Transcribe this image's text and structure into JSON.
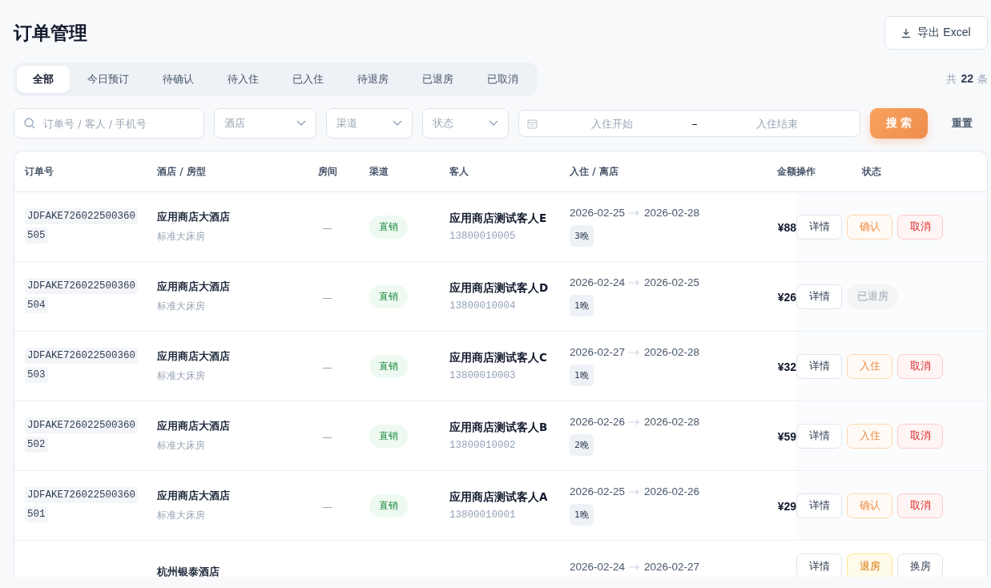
{
  "page_title": "订单管理",
  "export_button": "导出 Excel",
  "tabs": [
    {
      "label": "全部",
      "selected": true
    },
    {
      "label": "今日预订",
      "selected": false
    },
    {
      "label": "待确认",
      "selected": false
    },
    {
      "label": "待入住",
      "selected": false
    },
    {
      "label": "已入住",
      "selected": false
    },
    {
      "label": "待退房",
      "selected": false
    },
    {
      "label": "已退房",
      "selected": false
    },
    {
      "label": "已取消",
      "selected": false
    }
  ],
  "total": {
    "prefix": "共",
    "count": "22",
    "suffix": "条"
  },
  "filters": {
    "search_placeholder": "订单号 / 客人 / 手机号",
    "hotel_placeholder": "酒店",
    "channel_placeholder": "渠道",
    "status_placeholder": "状态",
    "date_start_placeholder": "入住开始",
    "date_separator": "–",
    "date_end_placeholder": "入住结束",
    "search_button": "搜 索",
    "reset_button": "重置"
  },
  "table": {
    "columns": [
      "订单号",
      "酒店 / 房型",
      "房间",
      "渠道",
      "客人",
      "入住 / 离店",
      "金额",
      "操作",
      "状态"
    ],
    "rows": [
      {
        "order_no": "JDFAKE726022500360505",
        "hotel": "应用商店大酒店",
        "room_type": "标准大床房",
        "room": "—",
        "channel": "直销",
        "guest": "应用商店测试客人E",
        "phone": "13800010005",
        "checkin": "2026-02-25",
        "checkout": "2026-02-28",
        "nights": "3晚",
        "amount": "¥88",
        "actions": [
          {
            "label": "详情",
            "kind": "default"
          },
          {
            "label": "确认",
            "kind": "warn"
          },
          {
            "label": "取消",
            "kind": "danger"
          }
        ]
      },
      {
        "order_no": "JDFAKE726022500360504",
        "hotel": "应用商店大酒店",
        "room_type": "标准大床房",
        "room": "—",
        "channel": "直销",
        "guest": "应用商店测试客人D",
        "phone": "13800010004",
        "checkin": "2026-02-24",
        "checkout": "2026-02-25",
        "nights": "1晚",
        "amount": "¥26",
        "actions": [
          {
            "label": "详情",
            "kind": "default"
          },
          {
            "label": "已退房",
            "kind": "disabled"
          }
        ]
      },
      {
        "order_no": "JDFAKE726022500360503",
        "hotel": "应用商店大酒店",
        "room_type": "标准大床房",
        "room": "—",
        "channel": "直销",
        "guest": "应用商店测试客人C",
        "phone": "13800010003",
        "checkin": "2026-02-27",
        "checkout": "2026-02-28",
        "nights": "1晚",
        "amount": "¥32",
        "actions": [
          {
            "label": "详情",
            "kind": "default"
          },
          {
            "label": "入住",
            "kind": "warn"
          },
          {
            "label": "取消",
            "kind": "danger"
          }
        ]
      },
      {
        "order_no": "JDFAKE726022500360502",
        "hotel": "应用商店大酒店",
        "room_type": "标准大床房",
        "room": "—",
        "channel": "直销",
        "guest": "应用商店测试客人B",
        "phone": "13800010002",
        "checkin": "2026-02-26",
        "checkout": "2026-02-28",
        "nights": "2晚",
        "amount": "¥59",
        "actions": [
          {
            "label": "详情",
            "kind": "default"
          },
          {
            "label": "入住",
            "kind": "warn"
          },
          {
            "label": "取消",
            "kind": "danger"
          }
        ]
      },
      {
        "order_no": "JDFAKE726022500360501",
        "hotel": "应用商店大酒店",
        "room_type": "标准大床房",
        "room": "—",
        "channel": "直销",
        "guest": "应用商店测试客人A",
        "phone": "13800010001",
        "checkin": "2026-02-25",
        "checkout": "2026-02-26",
        "nights": "1晚",
        "amount": "¥29",
        "actions": [
          {
            "label": "详情",
            "kind": "default"
          },
          {
            "label": "确认",
            "kind": "warn"
          },
          {
            "label": "取消",
            "kind": "danger"
          }
        ]
      },
      {
        "hotel": "杭州银泰酒店",
        "checkin": "2026-02-24",
        "checkout": "2026-02-27",
        "actions": [
          {
            "label": "详情",
            "kind": "default"
          },
          {
            "label": "退房",
            "kind": "yellow"
          },
          {
            "label": "换房",
            "kind": "default"
          }
        ]
      }
    ]
  }
}
